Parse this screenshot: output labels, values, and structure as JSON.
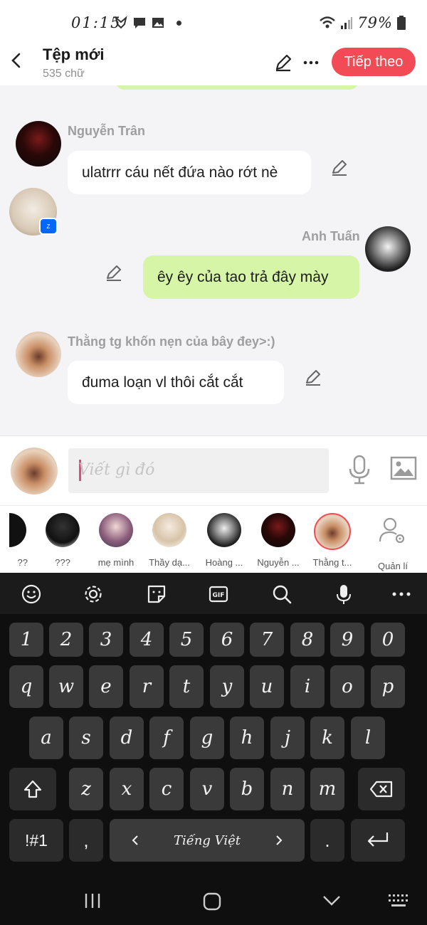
{
  "status_bar": {
    "time": "01:15",
    "battery": "79%"
  },
  "header": {
    "title": "Tệp mới",
    "word_count": "535 chữ",
    "next_button": "Tiếp theo"
  },
  "messages": [
    {
      "sender": "Nguyễn Trân",
      "text": "ulatrrr cáu nết đứa nào rớt nè",
      "side": "left"
    },
    {
      "sender": "Anh Tuấn",
      "text": "êy êy của tao trả đây mày",
      "side": "right"
    },
    {
      "sender": "Thằng tg khốn nẹn của bây đey>:)",
      "text": "đuma loạn vl thôi cắt cắt",
      "side": "left"
    }
  ],
  "input": {
    "placeholder": "Viết gì đó"
  },
  "characters": [
    {
      "name": "??"
    },
    {
      "name": "???"
    },
    {
      "name": "mẹ mình"
    },
    {
      "name": "Thầy dạ..."
    },
    {
      "name": "Hoàng ..."
    },
    {
      "name": "Nguyễn ..."
    },
    {
      "name": "Thằng t..."
    },
    {
      "name": "Quản lí"
    }
  ],
  "keyboard": {
    "row_numbers": [
      "1",
      "2",
      "3",
      "4",
      "5",
      "6",
      "7",
      "8",
      "9",
      "0"
    ],
    "row1": [
      "q",
      "w",
      "e",
      "r",
      "t",
      "y",
      "u",
      "i",
      "o",
      "p"
    ],
    "row2": [
      "a",
      "s",
      "d",
      "f",
      "g",
      "h",
      "j",
      "k",
      "l"
    ],
    "row3": [
      "z",
      "x",
      "c",
      "v",
      "b",
      "n",
      "m"
    ],
    "symbols_key": "!#1",
    "comma": ",",
    "space_label": "Tiếng Việt",
    "period": "."
  },
  "colors": {
    "accent": "#f24b55",
    "my_bubble": "#d6f5a7",
    "chat_bg": "#f4f4f6"
  }
}
